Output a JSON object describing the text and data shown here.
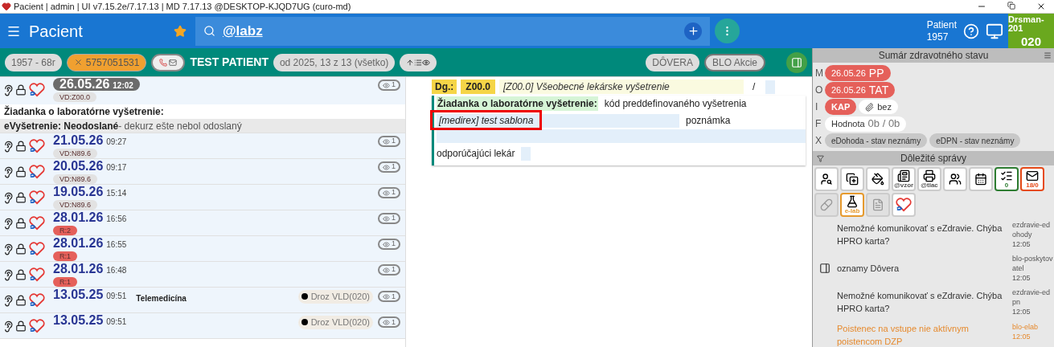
{
  "title_bar": {
    "title": "Pacient | admin | UI v7.15.2e/7.17.13 | MD 7.17.13 @DESKTOP-KJQD7UG (curo-md)"
  },
  "header": {
    "title": "Pacient",
    "search": "@labz",
    "patient_label": "Patient",
    "patient_year": "1957",
    "user": "Drsman-201",
    "user_code": "020"
  },
  "patient_bar": {
    "age": "1957 - 68r",
    "insurance_id": "5757051531",
    "name": "TEST PATIENT",
    "filter": "od 2025, 13 z 13 (všetko)",
    "insurer": "DÔVERA",
    "actions": "BLO Akcie"
  },
  "visits": [
    {
      "date": "26.05.26",
      "time": "12:02",
      "selected": true,
      "badge": "VD:Z00.0",
      "color": "#e2e2e2",
      "views": "1",
      "details": {
        "request": "Žiadanka o laboratórne vyšetrenie:",
        "status_bold": "eVyšetrenie: Neodoslané",
        "status_rest": " - dekurz ešte nebol odoslaný"
      }
    },
    {
      "date": "21.05.26",
      "time": "09:27",
      "selected": false,
      "badge": "VD:N89.6",
      "color": "#e2e2e2",
      "views": "1"
    },
    {
      "date": "20.05.26",
      "time": "09:17",
      "selected": false,
      "badge": "VD:N89.6",
      "color": "#e2e2e2",
      "views": "1"
    },
    {
      "date": "19.05.26",
      "time": "15:14",
      "selected": false,
      "badge": "VD:N89.6",
      "color": "#e2e2e2",
      "views": "1"
    },
    {
      "date": "28.01.26",
      "time": "16:56",
      "selected": false,
      "badge": "R:2",
      "color": "#e5605a",
      "views": "1"
    },
    {
      "date": "28.01.26",
      "time": "16:55",
      "selected": false,
      "badge": "R:1",
      "color": "#e5605a",
      "views": "1"
    },
    {
      "date": "28.01.26",
      "time": "16:48",
      "selected": false,
      "badge": "R:1",
      "color": "#e5605a",
      "views": "1"
    },
    {
      "date": "13.05.25",
      "time": "09:51",
      "selected": false,
      "label": "Telemedicína",
      "doctor": "Droz VLD(020)",
      "views": "1"
    },
    {
      "date": "13.05.25",
      "time": "09:51",
      "selected": false,
      "doctor": "Droz VLD(020)",
      "views": "1"
    }
  ],
  "form": {
    "dg_label": "Dg.:",
    "dg_code": "Z00.0",
    "dg_text": "[Z00.0] Všeobecné lekárske vyšetrenie",
    "dg_slash": "/",
    "request_label": "Žiadanka o laboratórne vyšetrenie:",
    "request_code": "kód preddefinovaného vyšetrenia",
    "template": "[medirex] test sablona",
    "note_label": "poznámka",
    "referrer_label": "odporúčajúci lekár"
  },
  "summary": {
    "title": "Sumár zdravotného stavu",
    "rows": [
      {
        "letter": "M",
        "chips": [
          {
            "kind": "alert",
            "date": "26.05.26",
            "text": "PP"
          }
        ]
      },
      {
        "letter": "O",
        "chips": [
          {
            "kind": "alert",
            "date": "26.05.26",
            "text": "TAT"
          }
        ]
      },
      {
        "letter": "I",
        "chips": [
          {
            "kind": "alert",
            "text": "KAP"
          },
          {
            "kind": "attachment",
            "text": "bez"
          }
        ]
      },
      {
        "letter": "F",
        "chips": [
          {
            "kind": "value",
            "text": "Hodnota",
            "value": "0b / 0b"
          }
        ]
      },
      {
        "letter": "X",
        "chips": [
          {
            "kind": "muted",
            "text": "eDohoda - stav neznámy"
          },
          {
            "kind": "muted",
            "text": "eDPN - stav neznámy"
          }
        ]
      }
    ]
  },
  "messages": {
    "title": "Dôležité správy",
    "tools": [
      {
        "kind": "person-search"
      },
      {
        "kind": "copy-add"
      },
      {
        "kind": "bucket"
      },
      {
        "kind": "template",
        "label": "@vzor"
      },
      {
        "kind": "printer",
        "label": "@tlac"
      },
      {
        "kind": "people"
      },
      {
        "kind": "calendar"
      },
      {
        "kind": "checklist",
        "label": "0",
        "color": "#2e7d32"
      },
      {
        "kind": "mail",
        "label": "18/0",
        "color": "#e64a19"
      },
      {
        "kind": "pills",
        "disabled": true
      },
      {
        "kind": "flask",
        "label": "e-lab",
        "color": "#e69a2e"
      },
      {
        "kind": "document",
        "disabled": true
      },
      {
        "kind": "heart"
      }
    ],
    "items": [
      {
        "text": "Nemožné komunikovať s eZdravie. Chýba HPRO karta?",
        "source": "ezdravie-edohody",
        "time": "12:05",
        "warning": false,
        "icon": false
      },
      {
        "text": "oznamy Dôvera",
        "source": "blo-poskytovatel",
        "time": "12:05",
        "warning": false,
        "icon": true
      },
      {
        "text": "Nemožné komunikovať s eZdravie. Chýba HPRO karta?",
        "source": "ezdravie-edpn",
        "time": "12:05",
        "warning": false,
        "icon": false
      },
      {
        "text": "Poistenec na vstupe nie aktívnym poistencom DZP",
        "source": "blo-elab",
        "time": "12:05",
        "warning": true,
        "icon": false
      }
    ]
  }
}
